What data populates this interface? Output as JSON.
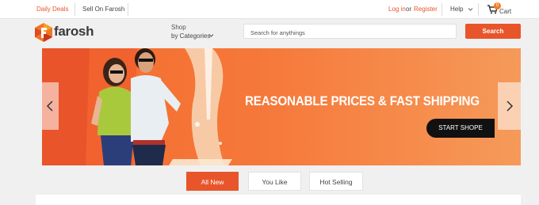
{
  "topbar": {
    "daily_deals": "Daily Deals",
    "sell_on": "Sell On Farosh",
    "login": "Log in",
    "or": "or",
    "register": "Register",
    "help": "Help",
    "cart_label": "Cart",
    "cart_count": "0"
  },
  "header": {
    "logo_text": "farosh",
    "shop_line1": "Shop",
    "shop_line2": "by Categories",
    "search_placeholder": "Search for anythings",
    "search_button": "Search"
  },
  "banner": {
    "headline": "REASONABLE PRICES & FAST SHIPPING",
    "cta": "START SHOPE"
  },
  "tabs": [
    {
      "label": "All New",
      "active": true
    },
    {
      "label": "You Like",
      "active": false
    },
    {
      "label": "Hot Selling",
      "active": false
    }
  ],
  "colors": {
    "accent": "#e8552b",
    "banner": "#f5783a",
    "background": "#f0f0f0"
  },
  "icons": [
    "chevron-down-icon",
    "cart-icon",
    "logo-icon",
    "chevron-left-icon",
    "chevron-right-icon"
  ]
}
